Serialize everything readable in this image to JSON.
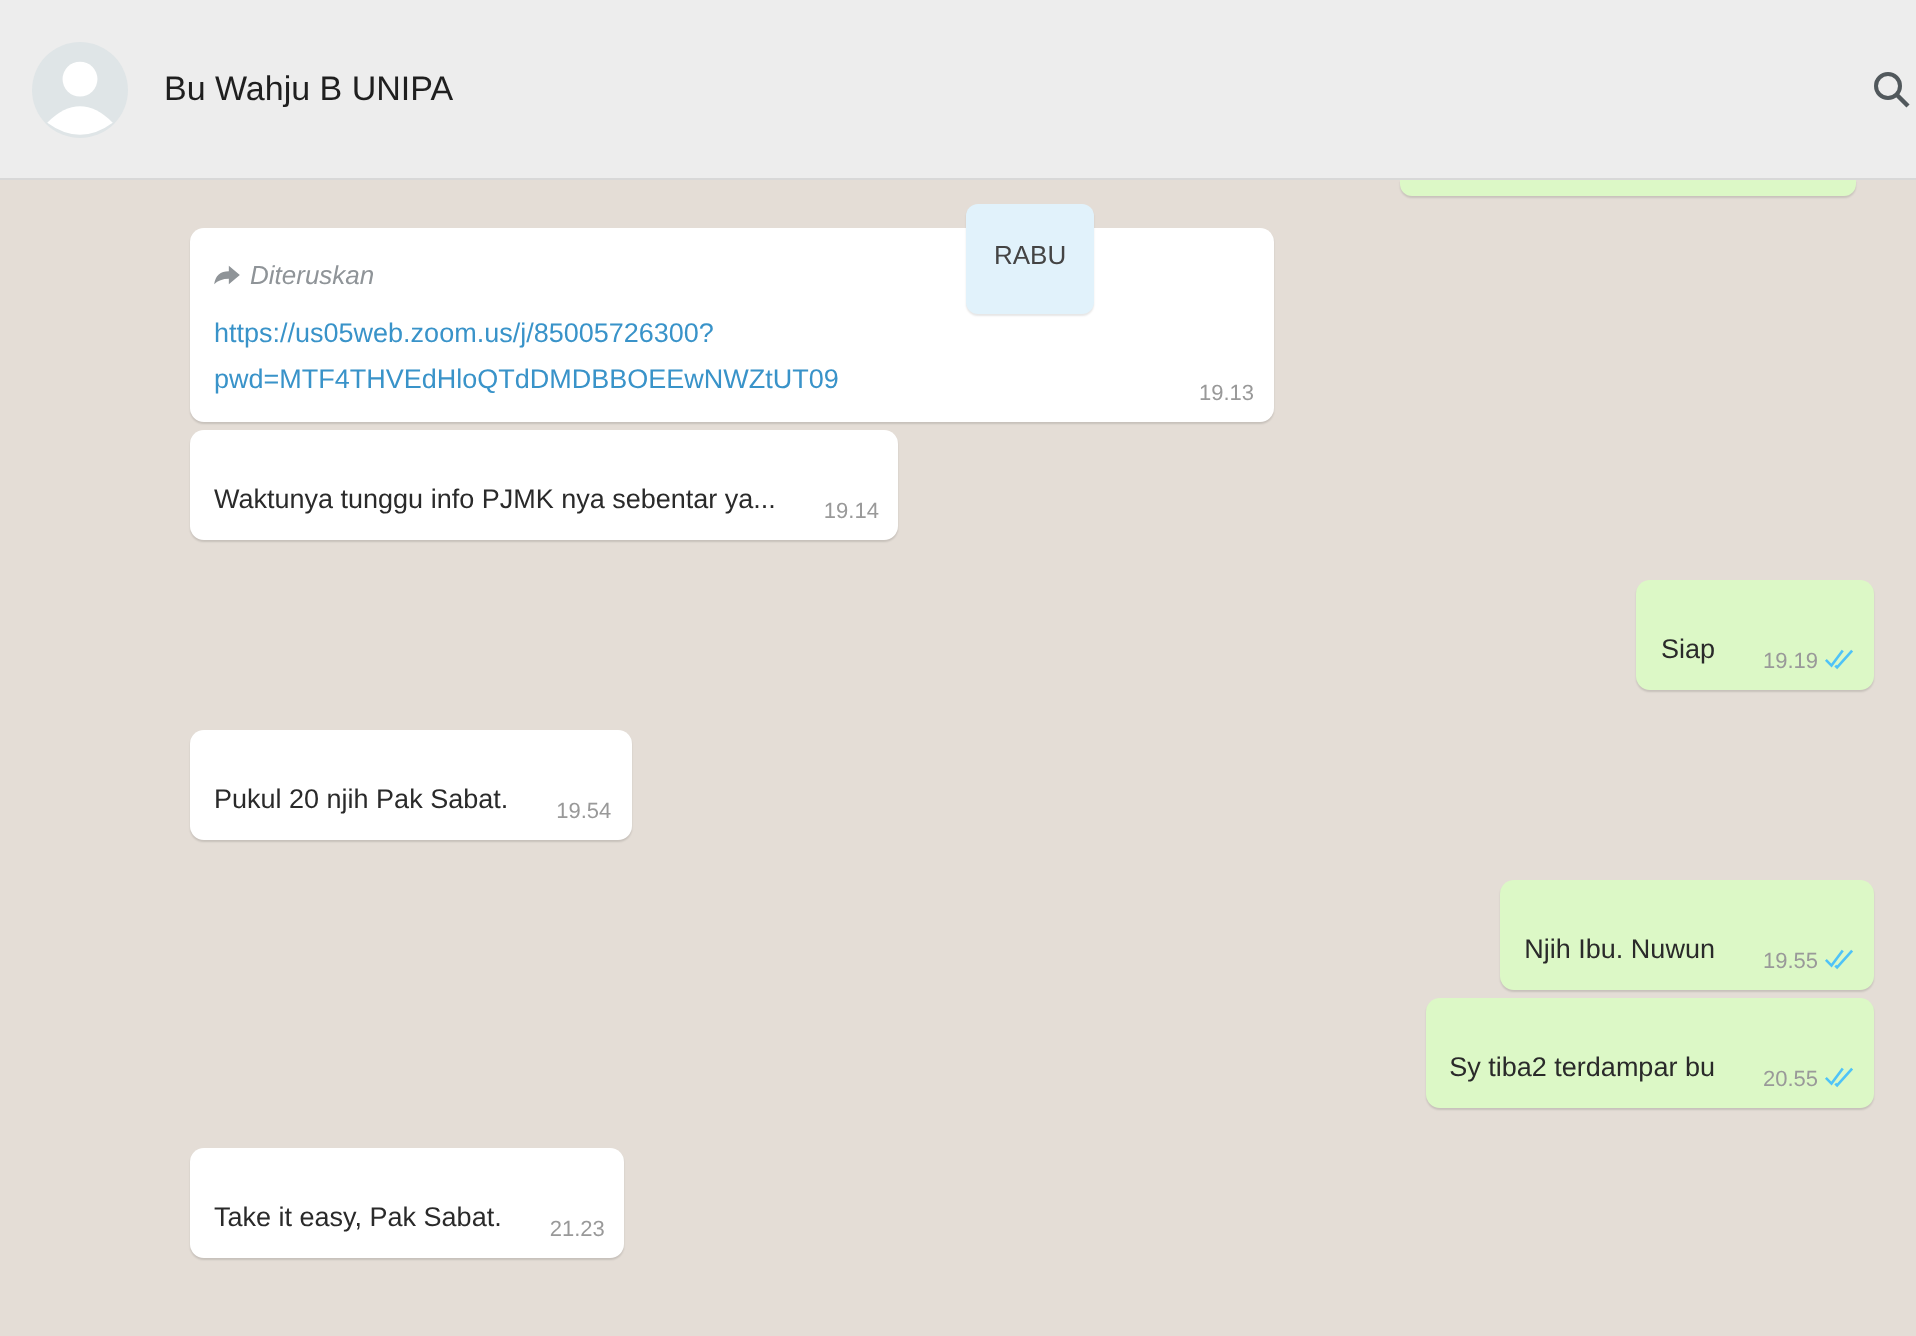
{
  "header": {
    "contact_name": "Bu Wahju B UNIPA"
  },
  "date_chip": "RABU",
  "messages": [
    {
      "kind": "incoming",
      "forwarded": true,
      "forward_label": "Diteruskan",
      "link": "https://us05web.zoom.us/j/85005726300?pwd=MTF4THVEdHloQTdDMDBBOEEwNWZtUT09",
      "time": "19.13"
    },
    {
      "kind": "incoming",
      "text": "Waktunya tunggu info PJMK nya sebentar ya...",
      "time": "19.14"
    },
    {
      "kind": "outgoing",
      "text": "Siap",
      "time": "19.19",
      "read": true
    },
    {
      "kind": "incoming",
      "text": "Pukul 20 njih Pak Sabat.",
      "time": "19.54"
    },
    {
      "kind": "outgoing",
      "text": "Njih Ibu. Nuwun",
      "time": "19.55",
      "read": true
    },
    {
      "kind": "outgoing",
      "text": "Sy tiba2 terdampar bu",
      "time": "20.55",
      "read": true
    },
    {
      "kind": "incoming",
      "text": "Take it easy, Pak Sabat.",
      "time": "21.23"
    }
  ]
}
